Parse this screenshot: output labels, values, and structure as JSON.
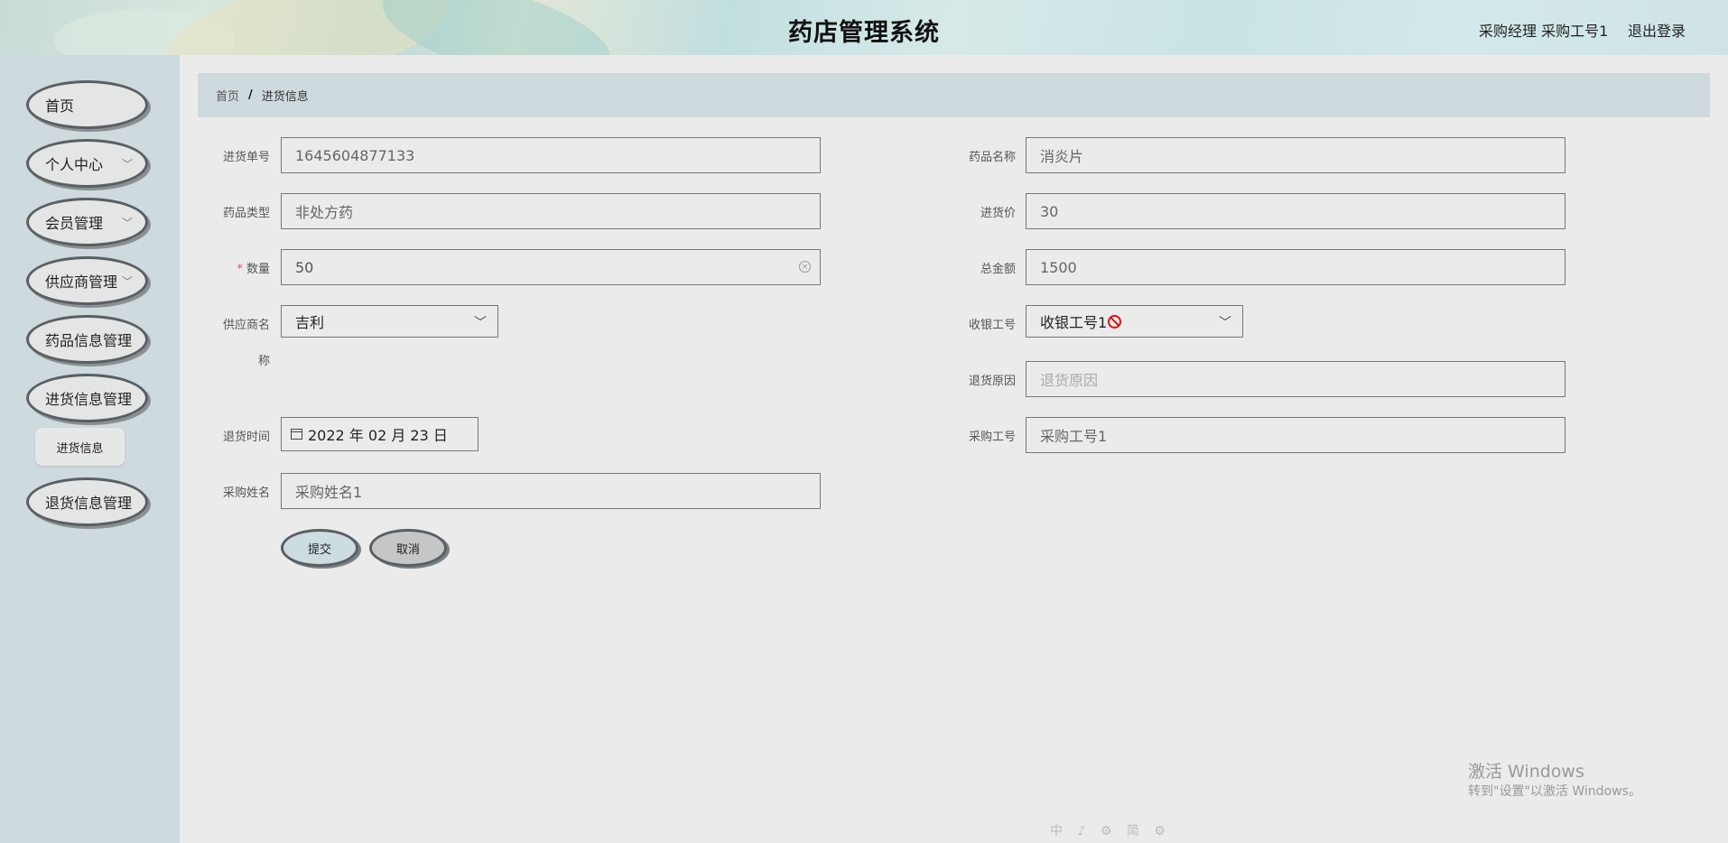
{
  "header": {
    "title": "药店管理系统",
    "user": "采购经理 采购工号1",
    "logout": "退出登录"
  },
  "sidebar": {
    "items": [
      {
        "label": "首页"
      },
      {
        "label": "个人中心",
        "has_submenu": true
      },
      {
        "label": "会员管理",
        "has_submenu": true
      },
      {
        "label": "供应商管理",
        "has_submenu": true
      },
      {
        "label": "药品信息管理"
      },
      {
        "label": "进货信息管理"
      },
      {
        "label": "退货信息管理"
      }
    ],
    "sub_item": "进货信息"
  },
  "breadcrumb": {
    "home": "首页",
    "separator": "/",
    "current": "进货信息"
  },
  "form": {
    "order_no": {
      "label": "进货单号",
      "value": "1645604877133"
    },
    "drug_name": {
      "label": "药品名称",
      "value": "消炎片"
    },
    "drug_type": {
      "label": "药品类型",
      "value": "非处方药"
    },
    "purchase_price": {
      "label": "进货价",
      "value": "30"
    },
    "quantity": {
      "label": "数量",
      "required_mark": "*",
      "value": "50"
    },
    "total": {
      "label": "总金额",
      "value": "1500"
    },
    "supplier": {
      "label_line1": "供应商名",
      "label_line2": "称",
      "value": "吉利"
    },
    "cashier_no": {
      "label": "收银工号",
      "value": "收银工号1"
    },
    "return_reason": {
      "label": "退货原因",
      "placeholder": "退货原因"
    },
    "return_time": {
      "label": "退货时间",
      "value": "2022 年 02 月 23 日"
    },
    "buyer_no": {
      "label": "采购工号",
      "value": "采购工号1"
    },
    "buyer_name": {
      "label": "采购姓名",
      "value": "采购姓名1"
    },
    "submit": "提交",
    "cancel": "取消"
  },
  "watermark": {
    "line1": "激活 Windows",
    "line2": "转到\"设置\"以激活 Windows。"
  },
  "tray": "中 ♪ ⚙ 简 ⚙"
}
